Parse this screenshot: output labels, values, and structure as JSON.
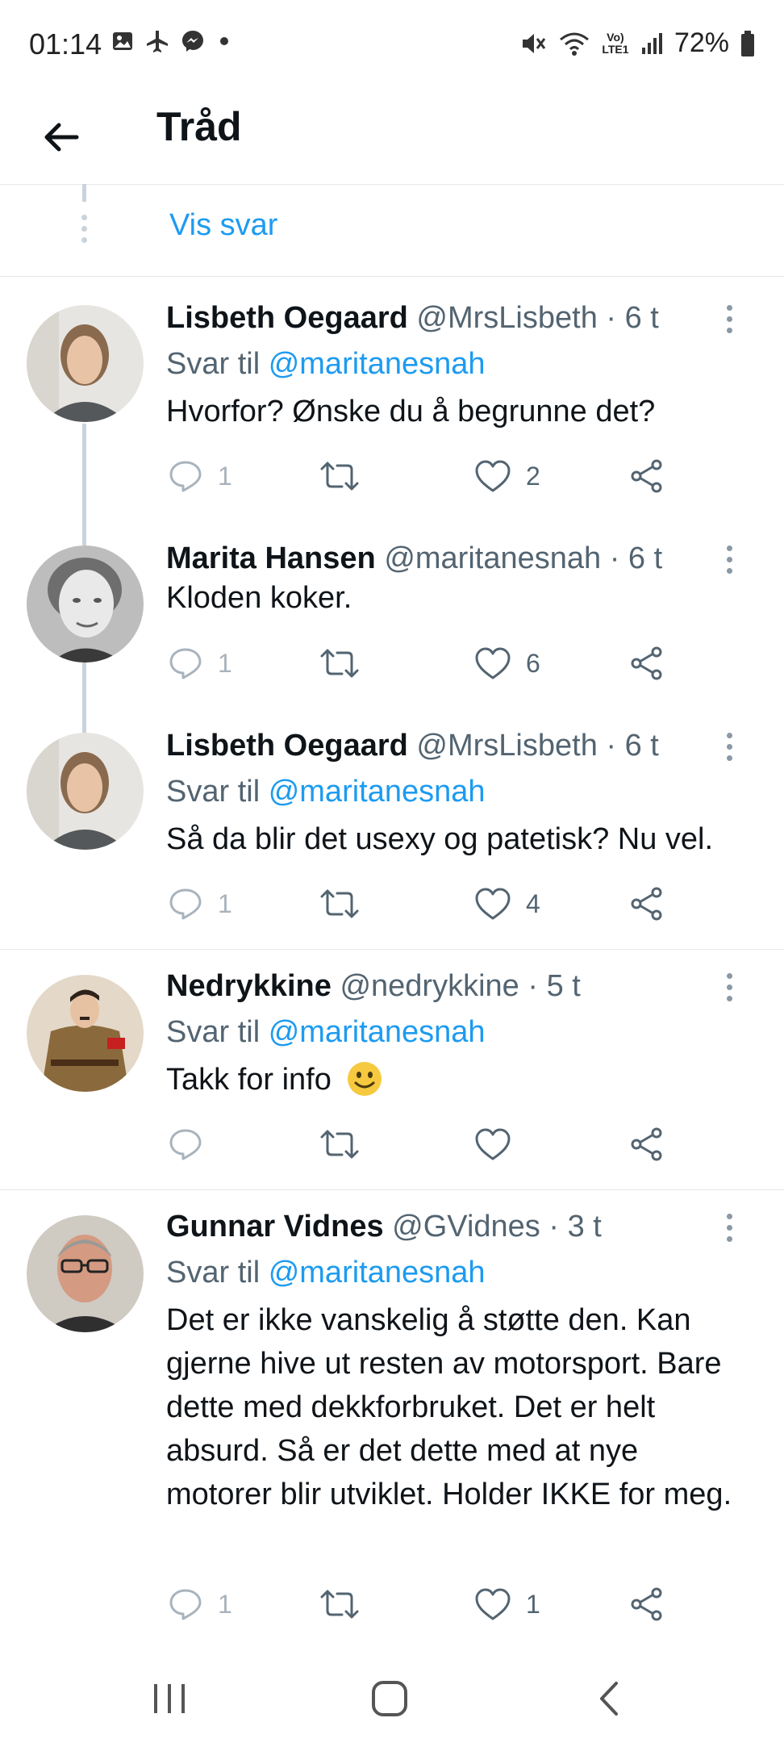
{
  "status_bar": {
    "time": "01:14",
    "battery": "72%",
    "network_label": "Vo) LTE1",
    "icons_left": [
      "gallery-icon",
      "airplane-icon",
      "messenger-icon",
      "dot-icon"
    ],
    "icons_right": [
      "mute-icon",
      "wifi-icon",
      "signal-icon",
      "battery-icon"
    ]
  },
  "header": {
    "title": "Tråd"
  },
  "thread": {
    "show_replies_label": "Vis svar"
  },
  "tweets": [
    {
      "name": "Lisbeth Oegaard",
      "handle": "@MrsLisbeth",
      "separator": "·",
      "time": "6 t",
      "reply_prefix": "Svar til",
      "reply_to": "@maritanesnah",
      "text": "Hvorfor? Ønske du å begrunne det?",
      "replies": "1",
      "retweets": "",
      "likes": "2"
    },
    {
      "name": "Marita Hansen",
      "handle": "@maritanesnah",
      "separator": "·",
      "time": "6 t",
      "text": "Kloden koker.",
      "replies": "1",
      "retweets": "",
      "likes": "6"
    },
    {
      "name": "Lisbeth Oegaard",
      "handle": "@MrsLisbeth",
      "separator": "·",
      "time": "6 t",
      "reply_prefix": "Svar til",
      "reply_to": "@maritanesnah",
      "text": "Så da blir det usexy og patetisk? Nu vel.",
      "replies": "1",
      "retweets": "",
      "likes": "4"
    },
    {
      "name": "Nedrykkine",
      "handle": "@nedrykkine",
      "separator": "·",
      "time": "5 t",
      "reply_prefix": "Svar til",
      "reply_to": "@maritanesnah",
      "text": "Takk for info",
      "replies": "",
      "retweets": "",
      "likes": ""
    },
    {
      "name": "Gunnar Vidnes",
      "handle": "@GVidnes",
      "separator": "·",
      "time": "3 t",
      "reply_prefix": "Svar til",
      "reply_to": "@maritanesnah",
      "text": "Det er ikke vanskelig å støtte den. Kan gjerne hive ut resten av motorsport. Bare dette med dekkforbruket. Det er helt absurd. Så er det dette med at nye motorer blir utviklet. Holder IKKE for meg.",
      "replies": "1",
      "retweets": "",
      "likes": "1"
    }
  ],
  "colors": {
    "accent": "#1d9bf0",
    "text_primary": "#0f1419",
    "text_secondary": "#536471",
    "divider": "#e6e9ec",
    "thread_line": "#c9d3db"
  }
}
